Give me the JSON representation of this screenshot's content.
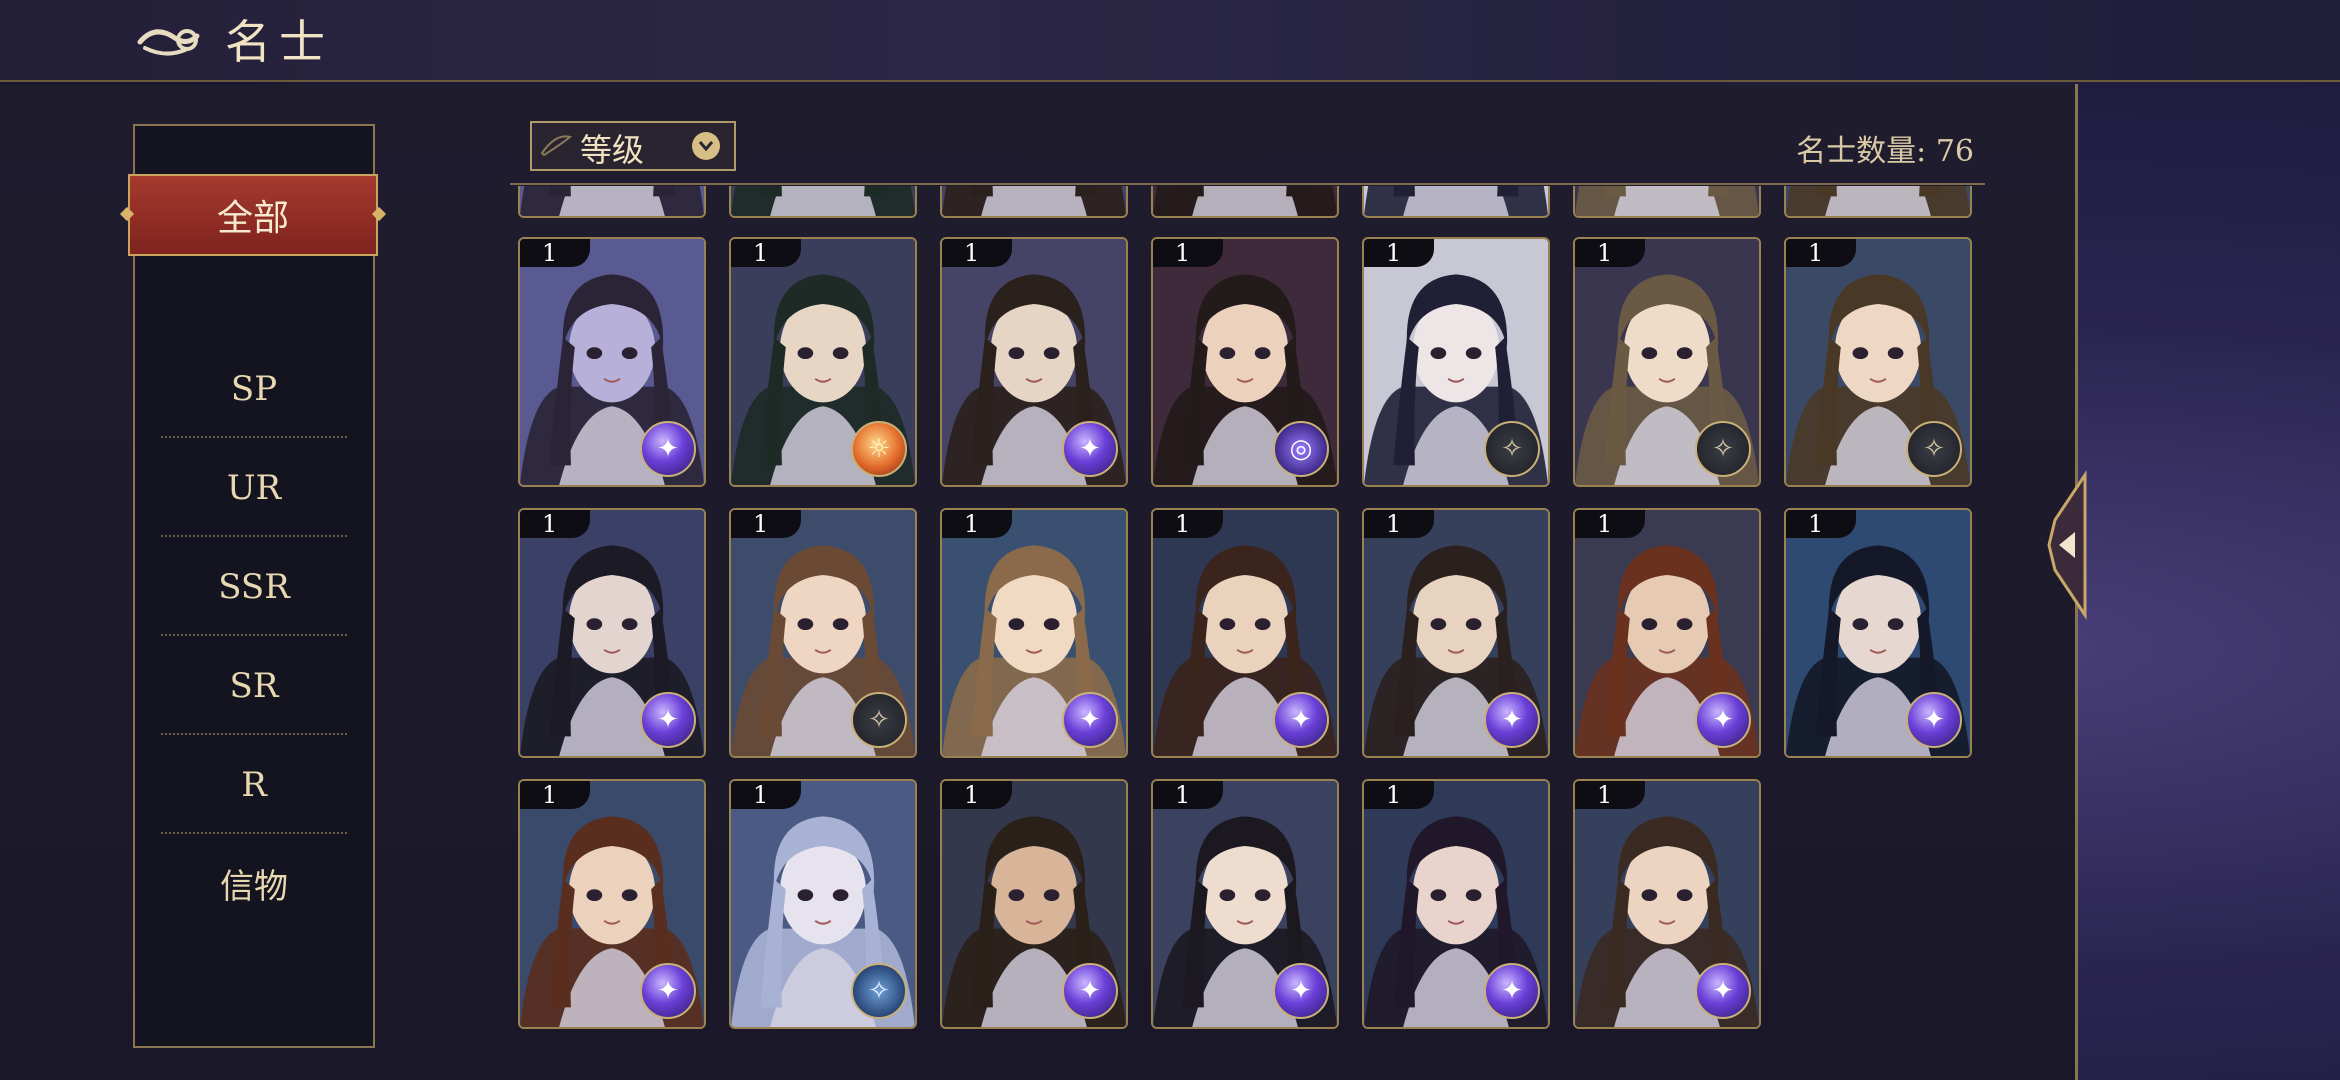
{
  "header": {
    "title": "名士"
  },
  "sidebar": {
    "active": "全部",
    "items": [
      {
        "label": "SP"
      },
      {
        "label": "UR"
      },
      {
        "label": "SSR"
      },
      {
        "label": "SR"
      },
      {
        "label": "R"
      },
      {
        "label": "信物"
      }
    ]
  },
  "toolbar": {
    "sort_label": "等级",
    "count_text": "名士数量: 76"
  },
  "cards": [
    {
      "level": "1",
      "badge": "orb",
      "skin": "#b7b0d8",
      "hair": "#2a2436",
      "bg": "#5a5a92"
    },
    {
      "level": "1",
      "badge": "sun",
      "skin": "#e8d6c4",
      "hair": "#1e2a26",
      "bg": "#3a3e5a"
    },
    {
      "level": "1",
      "badge": "orb",
      "skin": "#e6d4c4",
      "hair": "#2a201c",
      "bg": "#454466"
    },
    {
      "level": "1",
      "badge": "ring",
      "skin": "#ecd2bc",
      "hair": "#231a1a",
      "bg": "#3e2a3a"
    },
    {
      "level": "1",
      "badge": "dark",
      "skin": "#eee6e6",
      "hair": "#1f2036",
      "bg": "#c8c8d4"
    },
    {
      "level": "1",
      "badge": "dark",
      "skin": "#eedbc8",
      "hair": "#6a5a44",
      "bg": "#3a3650"
    },
    {
      "level": "1",
      "badge": "dark",
      "skin": "#eed8c4",
      "hair": "#4a3826",
      "bg": "#3a4a66"
    },
    {
      "level": "1",
      "badge": "orb",
      "skin": "#e4d4d0",
      "hair": "#1c1a24",
      "bg": "#3a4066"
    },
    {
      "level": "1",
      "badge": "dark",
      "skin": "#eed6c2",
      "hair": "#6a4a34",
      "bg": "#3e4c6c"
    },
    {
      "level": "1",
      "badge": "orb",
      "skin": "#f0dac4",
      "hair": "#8a6a4a",
      "bg": "#3a5070"
    },
    {
      "level": "1",
      "badge": "orb",
      "skin": "#ead2bc",
      "hair": "#3a241c",
      "bg": "#2e3852"
    },
    {
      "level": "1",
      "badge": "orb",
      "skin": "#e8d2c0",
      "hair": "#2a201e",
      "bg": "#36405a"
    },
    {
      "level": "1",
      "badge": "orb",
      "skin": "#e6cab4",
      "hair": "#6a321e",
      "bg": "#3a3a50"
    },
    {
      "level": "1",
      "badge": "orb",
      "skin": "#e6d8d0",
      "hair": "#141828",
      "bg": "#2e4a72"
    },
    {
      "level": "1",
      "badge": "orb",
      "skin": "#ecd2bc",
      "hair": "#5a2e1e",
      "bg": "#3a4a6a"
    },
    {
      "level": "1",
      "badge": "blue",
      "skin": "#e6e2ee",
      "hair": "#a8b2d4",
      "bg": "#4a5a84"
    },
    {
      "level": "1",
      "badge": "orb",
      "skin": "#d8b498",
      "hair": "#2a201a",
      "bg": "#34384c"
    },
    {
      "level": "1",
      "badge": "orb",
      "skin": "#eedcce",
      "hair": "#1c1820",
      "bg": "#3a4260"
    },
    {
      "level": "1",
      "badge": "orb",
      "skin": "#e8d4cc",
      "hair": "#20182a",
      "bg": "#2e3a58"
    },
    {
      "level": "1",
      "badge": "orb",
      "skin": "#ecd4c0",
      "hair": "#3a2a22",
      "bg": "#34405c"
    }
  ]
}
